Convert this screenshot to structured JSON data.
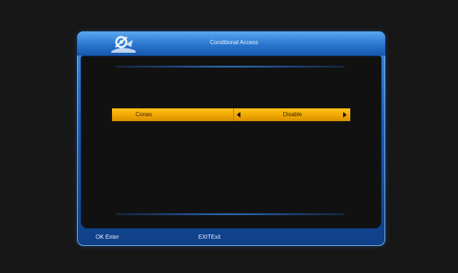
{
  "dialog": {
    "title": "Conditional Access",
    "logo_icon": "satellite-gear-logo"
  },
  "settings": [
    {
      "label": "Conax",
      "value": "Disable",
      "left_arrow_icon": "triangle-left-icon",
      "right_arrow_icon": "triangle-right-icon"
    }
  ],
  "footer": {
    "ok_key": "OK",
    "ok_action": "Enter",
    "exit_key": "EXIT",
    "exit_action": "Exit"
  },
  "colors": {
    "accent_blue": "#2a76cf",
    "highlight_row": "#f0a700",
    "background": "#171717"
  }
}
